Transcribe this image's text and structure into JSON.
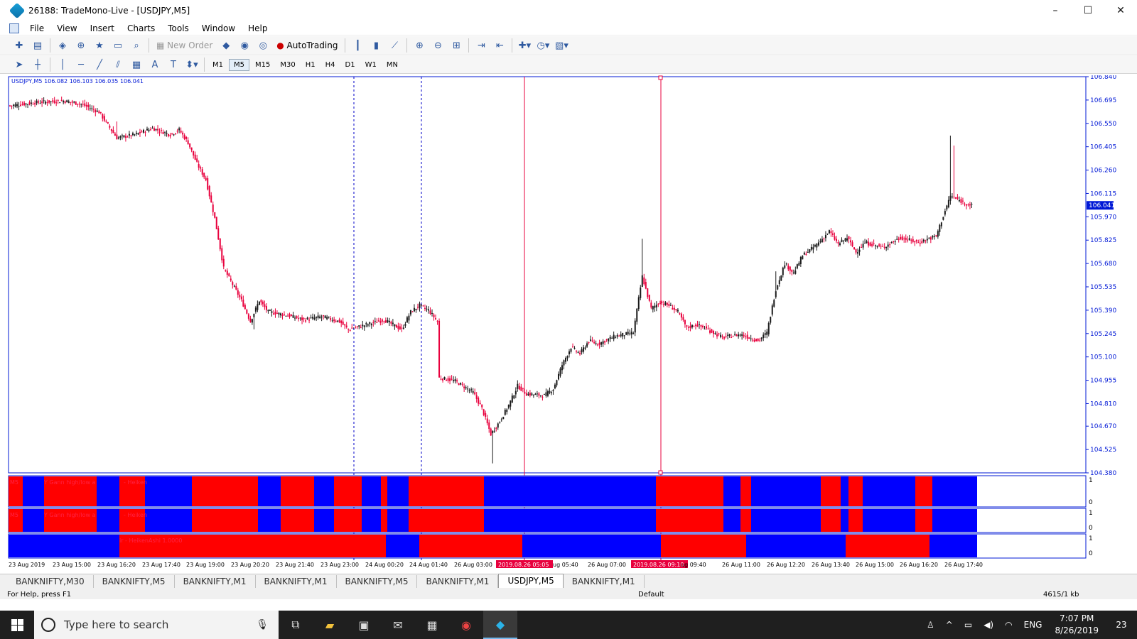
{
  "window": {
    "title": "26188: TradeMono-Live - [USDJPY,M5]",
    "minimize": "–",
    "maximize": "☐",
    "close": "✕"
  },
  "menu": [
    "File",
    "View",
    "Insert",
    "Charts",
    "Tools",
    "Window",
    "Help"
  ],
  "toolbar": {
    "new_order": "New Order",
    "autotrading": "AutoTrading"
  },
  "timeframes": [
    "M1",
    "M5",
    "M15",
    "M30",
    "H1",
    "H4",
    "D1",
    "W1",
    "MN"
  ],
  "active_timeframe": "M5",
  "chart_data": {
    "type": "candlestick",
    "symbol_info": "USDJPY,M5  106.082 106.103 106.035 106.041",
    "current_price": "106.041",
    "ylim": [
      104.38,
      106.84
    ],
    "y_ticks": [
      "106.840",
      "106.695",
      "106.550",
      "106.405",
      "106.260",
      "106.115",
      "105.970",
      "105.825",
      "105.680",
      "105.535",
      "105.390",
      "105.245",
      "105.100",
      "104.955",
      "104.810",
      "104.670",
      "104.525",
      "104.380"
    ],
    "x_ticks": [
      "23 Aug 2019",
      "23 Aug 15:00",
      "23 Aug 16:20",
      "23 Aug 17:40",
      "23 Aug 19:00",
      "23 Aug 20:20",
      "23 Aug 21:40",
      "23 Aug 23:00",
      "24 Aug 00:20",
      "24 Aug 01:40",
      "26 Aug 03:00",
      "2019.08.26 05:05",
      "ug 05:40",
      "26 Aug 07:00",
      "2019.08.26 09:10",
      "ug 09:40",
      "26 Aug 11:00",
      "26 Aug 12:20",
      "26 Aug 13:40",
      "26 Aug 15:00",
      "26 Aug 16:20",
      "26 Aug 17:40"
    ],
    "vertical_line_labels": [
      "2019.08.26 05:05",
      "2019.08.26 09:10"
    ],
    "close_path": [
      [
        0,
        106.66
      ],
      [
        15,
        106.68
      ],
      [
        30,
        106.69
      ],
      [
        40,
        106.67
      ],
      [
        50,
        106.62
      ],
      [
        60,
        106.46
      ],
      [
        70,
        106.48
      ],
      [
        80,
        106.52
      ],
      [
        90,
        106.48
      ],
      [
        95,
        106.51
      ],
      [
        100,
        106.43
      ],
      [
        105,
        106.3
      ],
      [
        110,
        106.2
      ],
      [
        115,
        105.96
      ],
      [
        120,
        105.65
      ],
      [
        125,
        105.55
      ],
      [
        130,
        105.45
      ],
      [
        135,
        105.32
      ],
      [
        140,
        105.45
      ],
      [
        145,
        105.38
      ],
      [
        155,
        105.36
      ],
      [
        165,
        105.33
      ],
      [
        175,
        105.35
      ],
      [
        185,
        105.32
      ],
      [
        190,
        105.27
      ],
      [
        200,
        105.3
      ],
      [
        210,
        105.33
      ],
      [
        220,
        105.27
      ],
      [
        225,
        105.38
      ],
      [
        230,
        105.42
      ],
      [
        235,
        105.39
      ],
      [
        240,
        105.32
      ],
      [
        241,
        104.97
      ],
      [
        250,
        104.95
      ],
      [
        260,
        104.88
      ],
      [
        265,
        104.78
      ],
      [
        270,
        104.62
      ],
      [
        275,
        104.7
      ],
      [
        280,
        104.8
      ],
      [
        285,
        104.92
      ],
      [
        290,
        104.87
      ],
      [
        300,
        104.86
      ],
      [
        305,
        104.9
      ],
      [
        310,
        105.05
      ],
      [
        315,
        105.16
      ],
      [
        320,
        105.12
      ],
      [
        325,
        105.2
      ],
      [
        330,
        105.18
      ],
      [
        340,
        105.23
      ],
      [
        350,
        105.25
      ],
      [
        355,
        105.6
      ],
      [
        360,
        105.4
      ],
      [
        365,
        105.44
      ],
      [
        370,
        105.42
      ],
      [
        375,
        105.38
      ],
      [
        380,
        105.28
      ],
      [
        385,
        105.3
      ],
      [
        390,
        105.28
      ],
      [
        395,
        105.25
      ],
      [
        400,
        105.22
      ],
      [
        410,
        105.24
      ],
      [
        420,
        105.2
      ],
      [
        425,
        105.25
      ],
      [
        430,
        105.52
      ],
      [
        435,
        105.68
      ],
      [
        440,
        105.62
      ],
      [
        445,
        105.73
      ],
      [
        450,
        105.77
      ],
      [
        455,
        105.82
      ],
      [
        460,
        105.88
      ],
      [
        465,
        105.8
      ],
      [
        470,
        105.84
      ],
      [
        475,
        105.75
      ],
      [
        480,
        105.81
      ],
      [
        490,
        105.78
      ],
      [
        500,
        105.84
      ],
      [
        510,
        105.81
      ],
      [
        520,
        105.85
      ],
      [
        528,
        106.1
      ],
      [
        535,
        106.06
      ],
      [
        540,
        106.04
      ]
    ],
    "indicator_panes": [
      {
        "name": "Gann high/low + HeikenAshi",
        "labels": [
          "M5",
          "Y Gann high/low a",
          "- Heiken"
        ],
        "y_ticks": [
          "1",
          "0"
        ]
      },
      {
        "name": "Gann high/low + HeikenAshi",
        "labels": [
          "M5",
          "Y Gann high/low a",
          "- Heiken"
        ],
        "y_ticks": [
          "1",
          "0"
        ]
      },
      {
        "name": "HeikenAshi",
        "labels": [
          "ir - HeikenAshi 1.0000"
        ],
        "y_ticks": [
          "1",
          "0"
        ]
      }
    ]
  },
  "chart_tabs": [
    "BANKNIFTY,M30",
    "BANKNIFTY,M5",
    "BANKNIFTY,M1",
    "BANKNIFTY,M1",
    "BANKNIFTY,M5",
    "BANKNIFTY,M1",
    "USDJPY,M5",
    "BANKNIFTY,M1"
  ],
  "active_tab": "USDJPY,M5",
  "status": {
    "help": "For Help, press F1",
    "profile": "Default",
    "traffic": "4615/1 kb"
  },
  "taskbar": {
    "search_placeholder": "Type here to search",
    "lang": "ENG",
    "time": "7:07 PM",
    "date": "8/26/2019",
    "notifications": "23"
  },
  "colors": {
    "bull": "#1a1a1a",
    "bear": "#e8003d",
    "indicator_red": "#ff0000",
    "indicator_blue": "#0000ff",
    "axis": "#0018d6",
    "vline": "#e8003d"
  }
}
